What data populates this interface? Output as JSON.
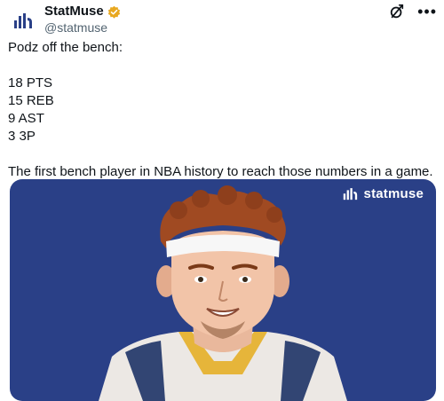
{
  "account": {
    "display_name": "StatMuse",
    "handle": "@statmuse"
  },
  "post": {
    "line1": "Podz off the bench:",
    "stats": [
      "18 PTS",
      "15 REB",
      "9 AST",
      "3 3P"
    ],
    "closing": "The first bench player in NBA history to reach those numbers in a game."
  },
  "card": {
    "brand_text": "statmuse"
  },
  "colors": {
    "card_bg": "#2a4087",
    "verified_badge": "#e8a820",
    "handle_text": "#536471"
  },
  "icons": [
    "statmuse-logo-icon",
    "verified-badge-icon",
    "grok-icon",
    "more-options-icon"
  ]
}
